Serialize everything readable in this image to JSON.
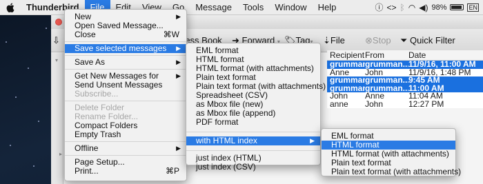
{
  "menubar": {
    "app": "Thunderbird",
    "items": [
      "File",
      "Edit",
      "View",
      "Go",
      "Message",
      "Tools",
      "Window",
      "Help"
    ],
    "active": "File",
    "status": {
      "icons": [
        "info-icon",
        "code-arrows-icon",
        "bluetooth-icon",
        "wifi-icon",
        "volume-icon"
      ],
      "battery": "98%",
      "battery_icon": "EN"
    }
  },
  "toolbar": {
    "address_book": "ress Book",
    "forward": "Forward",
    "tag": "Tag",
    "file": "File",
    "stop": "Stop",
    "quick_filter": "Quick Filter"
  },
  "columns": [
    "Recipient",
    "From",
    "Date"
  ],
  "messages": [
    {
      "recipient": "grumman",
      "from": "grumman...",
      "date": "11/9/16, 11:00 AM",
      "selected": true
    },
    {
      "recipient": "Anne",
      "from": "John",
      "date": "11/9/16, 1:48 PM",
      "selected": false
    },
    {
      "recipient": "grumman",
      "from": "grumman...",
      "date": "9:45 AM",
      "selected": true
    },
    {
      "recipient": "grumman",
      "from": "grumman...",
      "date": "11:00 AM",
      "selected": true
    },
    {
      "recipient": "John",
      "from": "Anne",
      "date": "11:04 AM",
      "selected": false
    },
    {
      "recipient": "anne",
      "from": "John",
      "date": "12:27 PM",
      "selected": false
    }
  ],
  "file_menu": {
    "new": "New",
    "open_saved": "Open Saved Message...",
    "close": "Close",
    "close_sc": "⌘W",
    "save_selected": "Save selected messages",
    "save_as": "Save As",
    "get_new": "Get New Messages for",
    "send_unsent": "Send Unsent Messages",
    "subscribe": "Subscribe...",
    "delete_folder": "Delete Folder",
    "rename_folder": "Rename Folder...",
    "compact": "Compact Folders",
    "empty_trash": "Empty Trash",
    "offline": "Offline",
    "page_setup": "Page Setup...",
    "print": "Print...",
    "print_sc": "⌘P"
  },
  "save_submenu": {
    "items": [
      "EML format",
      "HTML format",
      "HTML format (with attachments)",
      "Plain text format",
      "Plain text format (with attachments)",
      "Spreadsheet (CSV)",
      "as Mbox file (new)",
      "as Mbox file (append)",
      "PDF format"
    ],
    "with_html_index": "with HTML index",
    "just_index_html": "just index (HTML)",
    "just_index_csv": "just index (CSV)"
  },
  "index_submenu": {
    "items": [
      "EML format",
      "HTML format",
      "HTML format (with attachments)",
      "Plain text format",
      "Plain text format (with attachments)"
    ],
    "highlighted": 1
  }
}
